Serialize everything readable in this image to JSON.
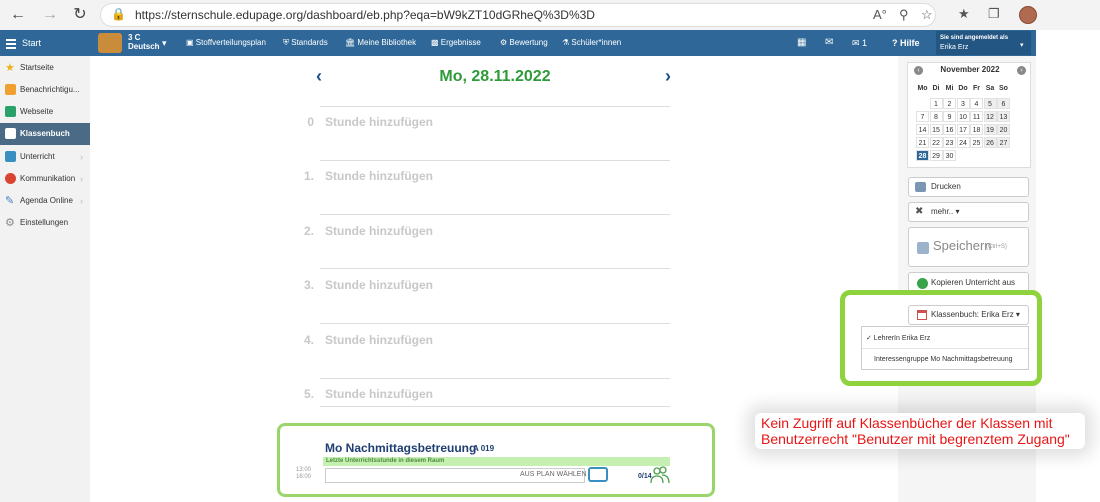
{
  "browser": {
    "url": "https://sternschule.edupage.org/dashboard/eb.php?eqa=bW9kZT10dGRheQ%3D%3D",
    "zoom_icon": "A°"
  },
  "header": {
    "start_label": "Start",
    "class_name": "3 C",
    "class_subject": "Deutsch",
    "nav": [
      {
        "label": "Stoffverteilungsplan",
        "icon": "table-icon"
      },
      {
        "label": "Standards",
        "icon": "shield-icon"
      },
      {
        "label": "Meine Bibliothek",
        "icon": "library-icon"
      },
      {
        "label": "Ergebnisse",
        "icon": "bar-chart-icon"
      },
      {
        "label": "Bewertung",
        "icon": "gear-icon"
      },
      {
        "label": "Schüler*innen",
        "icon": "students-icon"
      }
    ],
    "messages_count": "1",
    "help_label": "Hilfe",
    "user_caption": "Sie sind angemeldet als",
    "user_name": "Erika Erz"
  },
  "sidebar": {
    "items": [
      {
        "label": "Startseite",
        "icon": "star-icon",
        "color": "#f0b21a"
      },
      {
        "label": "Benachrichtigu...",
        "icon": "envelope-icon",
        "color": "#f0a030"
      },
      {
        "label": "Webseite",
        "icon": "house-icon",
        "color": "#2aa06b"
      },
      {
        "label": "Klassenbuch",
        "icon": "book-icon",
        "color": "#ffffff",
        "active": true
      },
      {
        "label": "Unterricht",
        "icon": "briefcase-icon",
        "color": "#3a8fc2"
      },
      {
        "label": "Kommunikation",
        "icon": "chat-icon",
        "color": "#d9432f"
      },
      {
        "label": "Agenda Online",
        "icon": "pen-icon",
        "color": "#4b7fc4"
      },
      {
        "label": "Einstellungen",
        "icon": "gear-icon",
        "color": "#8a8a8a"
      }
    ]
  },
  "main": {
    "date": "Mo, 28.11.2022",
    "lessons": [
      {
        "num": "0",
        "label": "Stunde hinzufügen"
      },
      {
        "num": "1.",
        "label": "Stunde hinzufügen"
      },
      {
        "num": "2.",
        "label": "Stunde hinzufügen"
      },
      {
        "num": "3.",
        "label": "Stunde hinzufügen"
      },
      {
        "num": "4.",
        "label": "Stunde hinzufügen"
      },
      {
        "num": "5.",
        "label": "Stunde hinzufügen"
      }
    ],
    "activity": {
      "title": "Mo Nachmittagsbetreuung",
      "room": "A 019",
      "last_lesson": "Letzte Unterrichtsstunde in diesem Raum",
      "time_start": "13:00",
      "time_end": "16:00",
      "plan_label": "AUS PLAN WÄHLEN",
      "count": "0/14"
    }
  },
  "calendar": {
    "month": "November 2022",
    "weekdays": [
      "Mo",
      "Di",
      "Mi",
      "Do",
      "Fr",
      "Sa",
      "So"
    ],
    "weeks": [
      [
        "",
        "1",
        "2",
        "3",
        "4",
        "5",
        "6"
      ],
      [
        "7",
        "8",
        "9",
        "10",
        "11",
        "12",
        "13"
      ],
      [
        "14",
        "15",
        "16",
        "17",
        "18",
        "19",
        "20"
      ],
      [
        "21",
        "22",
        "23",
        "24",
        "25",
        "26",
        "27"
      ],
      [
        "28",
        "29",
        "30",
        "",
        "",
        "",
        ""
      ]
    ],
    "selected": "28"
  },
  "actions": {
    "print": "Drucken",
    "more": "mehr.. ▾",
    "save": "Speichern",
    "save_shortcut": "(Ctrl+S)",
    "copy": "Kopieren Unterricht aus",
    "classbook": "Klassenbuch: Erika Erz ▾",
    "dropdown": [
      "✓ LehrerIn Erika Erz",
      "Interessengruppe Mo Nachmittagsbetreuung"
    ]
  },
  "annotation": {
    "text": "Kein Zugriff auf Klassenbücher der Klassen mit Benutzerrecht \"Benutzer mit begrenztem Zugang\""
  }
}
